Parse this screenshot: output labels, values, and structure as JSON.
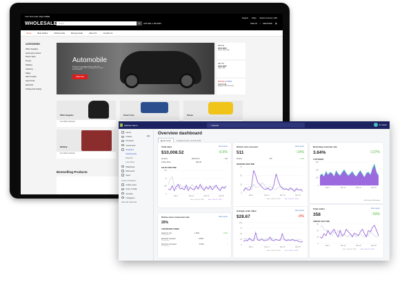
{
  "website": {
    "announcement": "Your first order ships FREE",
    "logo": "WHOLESALE",
    "search_placeholder": "Search",
    "hotline": "HOTLINE: 1 300 3000",
    "top_links": [
      "Support",
      "FAQs",
      "Select Currency: USD"
    ],
    "account_links": [
      "SIGN IN",
      "/",
      "REGISTER"
    ],
    "nav": [
      "Home",
      "Best Sellers",
      "All New Sale",
      "Buying Guide",
      "About Us",
      "Contact Us"
    ],
    "categories_title": "CATEGORIES",
    "categories": [
      "Office Supplies",
      "Automotive Interior",
      "Power Tools",
      "Pumps",
      "Welding",
      "Cleaning",
      "Safety",
      "LED & Lights",
      "Hand Tools",
      "Electrical",
      "Tooling And Cutting"
    ],
    "banner": {
      "title": "Automobile",
      "text": "We have an exceptional team, built to the customer's office. We constantly strive to push the boundaries",
      "button": "Shop Now"
    },
    "promos": [
      {
        "tag": "UP TO",
        "deal": "10% OFF",
        "sub": "Power Tools Sale"
      },
      {
        "tag": "UP TO",
        "deal": "10% OFF",
        "sub": "Office Sale"
      },
      {
        "brands": [
          "BOSCH",
          "INTEX",
          "Industrial"
        ],
        "sub": "Bargains 30% Discount"
      }
    ],
    "tiles": [
      {
        "label": "Office Supplies",
        "link": "See Whole Collection"
      },
      {
        "label": "Power Tools",
        "link": ""
      },
      {
        "label": "Pumps",
        "link": ""
      },
      {
        "label": "Welding",
        "link": "See Whole Collection"
      }
    ],
    "bestselling": "Bestselling Products"
  },
  "dashboard": {
    "store_name": "Website Name",
    "search_placeholder": "Search",
    "user": "Jo Heart",
    "sidebar": [
      {
        "label": "Home"
      },
      {
        "label": "Orders",
        "badge": "100"
      },
      {
        "label": "Products"
      },
      {
        "label": "Customers"
      },
      {
        "label": "Analytics",
        "active": true
      },
      {
        "label": "Dashboards",
        "sub": true,
        "active": true
      },
      {
        "label": "Reports",
        "sub": true
      },
      {
        "label": "Live View",
        "sub": true
      },
      {
        "label": "Marketing"
      },
      {
        "label": "Discounts"
      },
      {
        "label": "Apps"
      }
    ],
    "sales_channels_title": "SALES CHANNELS",
    "channels": [
      "Online store",
      "Point of Sale",
      "Amazon",
      "Instagram"
    ],
    "view_all": "View all channels",
    "title": "Overview dashboard",
    "date_button": "Last month",
    "compared": "compared to Feb 1–Feb 28, 2019",
    "view_report": "View report",
    "legend": [
      "Feb 1–Feb 28, 2019",
      "Mar 1–Mar 31, 2019"
    ],
    "x_ticks": [
      "Mar 4",
      "Mar 11",
      "Mar 18",
      "Mar 25"
    ],
    "cards": {
      "total_sales": {
        "title": "Total sales",
        "value": "$10,008.52",
        "change": "↑0.5%",
        "rows": [
          [
            "Amazon",
            "$5,078.23",
            "↑ 2%"
          ],
          [
            "Online Store",
            "$32.28",
            "–"
          ]
        ],
        "chart_title": "SALES OVER TIME",
        "y_ticks": [
          "1.5k",
          "1k",
          "500",
          "0"
        ],
        "current": [
          300,
          250,
          500,
          200,
          450,
          600,
          300,
          350,
          250,
          550,
          200,
          400,
          300,
          250,
          500,
          300,
          600,
          350,
          200,
          450,
          300,
          500,
          250,
          400,
          550,
          300,
          200,
          450,
          350,
          500
        ],
        "previous": [
          600,
          900,
          1100,
          500,
          300,
          400,
          600,
          350,
          500,
          300,
          450,
          400,
          600,
          350,
          300,
          400,
          350,
          500,
          300,
          400,
          350,
          300,
          450,
          500,
          350,
          400,
          300,
          350,
          400,
          300
        ],
        "max": 1500
      },
      "sessions": {
        "title": "Online store sessions",
        "value": "511",
        "change": "↑14%",
        "rows": [
          [
            "Visitors",
            "472",
            "↑ 10%"
          ]
        ],
        "chart_title": "SESSIONS OVER TIME",
        "y_ticks": [
          "75",
          "50",
          "25",
          "0"
        ],
        "current": [
          5,
          15,
          10,
          8,
          20,
          65,
          50,
          30,
          25,
          18,
          12,
          10,
          15,
          8,
          10,
          25,
          55,
          35,
          20,
          15,
          10,
          12,
          8,
          15,
          10,
          5,
          12,
          8,
          10,
          5
        ],
        "previous": [
          10,
          12,
          15,
          20,
          10,
          25,
          15,
          18,
          20,
          30,
          25,
          15,
          10,
          20,
          15,
          12,
          10,
          15,
          20,
          10,
          15,
          12,
          10,
          8,
          12,
          10,
          15,
          8,
          10,
          12
        ],
        "max": 75
      },
      "returning": {
        "title": "Returning customer rate",
        "value": "3.64%",
        "change": "↑137%",
        "chart_title": "CUSTOMERS",
        "y_ticks": [
          "300",
          "200",
          "100",
          "0"
        ],
        "legend": [
          "First-time",
          "Returning"
        ],
        "first": [
          120,
          140,
          110,
          170,
          130,
          160,
          150,
          110,
          180,
          140,
          120,
          160,
          190,
          150,
          120,
          140,
          170,
          130,
          110,
          150,
          180,
          140,
          100,
          150,
          160,
          130,
          210,
          250,
          160,
          120
        ],
        "returning": [
          10,
          12,
          8,
          15,
          10,
          12,
          10,
          8,
          14,
          12,
          10,
          12,
          15,
          12,
          10,
          12,
          14,
          10,
          8,
          12,
          14,
          10,
          8,
          12,
          14,
          10,
          16,
          30,
          12,
          10
        ],
        "max": 300
      },
      "conversion": {
        "title": "Online store conversion rate",
        "value": "20%",
        "subtitle": "CONVERSION FUNNEL",
        "rows": [
          [
            "Added to cart",
            "1.05%",
            "↑ 4.5%",
            "12 sessions"
          ],
          [
            "Reached checkout",
            "0.55%",
            "–",
            "11 sessions"
          ],
          [
            "Sessions converted",
            "0.20%",
            "–",
            "11 sessions"
          ]
        ]
      },
      "aov": {
        "title": "Average order value",
        "value": "$28.67",
        "change": "↓9%",
        "y_ticks": [
          "100",
          "75",
          "50",
          "25",
          "0"
        ],
        "current": [
          15,
          20,
          18,
          30,
          20,
          18,
          55,
          22,
          20,
          25,
          18,
          20,
          22,
          35,
          20,
          18,
          25,
          20,
          20,
          50,
          25,
          18,
          22,
          20,
          25,
          18,
          20,
          15,
          12,
          14
        ],
        "previous": [
          25,
          30,
          20,
          25,
          22,
          28,
          30,
          20,
          25,
          30,
          22,
          28,
          25,
          20,
          30,
          25,
          22,
          20,
          25,
          28,
          20,
          22,
          25,
          20,
          18,
          22,
          20,
          25,
          22,
          20
        ],
        "max": 100
      },
      "orders": {
        "title": "Total orders",
        "value": "358",
        "change": "↑50%",
        "chart_title": "ORDERS OVER TIME",
        "y_ticks": [
          "30",
          "20",
          "10",
          "0"
        ],
        "current": [
          10,
          8,
          15,
          12,
          20,
          14,
          18,
          22,
          15,
          10,
          20,
          12,
          14,
          22,
          18,
          15,
          10,
          16,
          14,
          12,
          18,
          22,
          15,
          10,
          20,
          18,
          25,
          28,
          20,
          12
        ],
        "previous": [
          25,
          28,
          22,
          20,
          18,
          15,
          12,
          18,
          15,
          20,
          12,
          10,
          14,
          12,
          10,
          15,
          12,
          14,
          10,
          12,
          15,
          12,
          10,
          14,
          12,
          18,
          15,
          12,
          10,
          12
        ],
        "max": 30
      }
    },
    "colors": {
      "header": "#1c2260",
      "current": "#9c6ade",
      "previous": "#c4cdd5",
      "returning": "#47c1bf",
      "up": "#50b83c",
      "down": "#de3618",
      "link": "#3a6dc5"
    }
  }
}
